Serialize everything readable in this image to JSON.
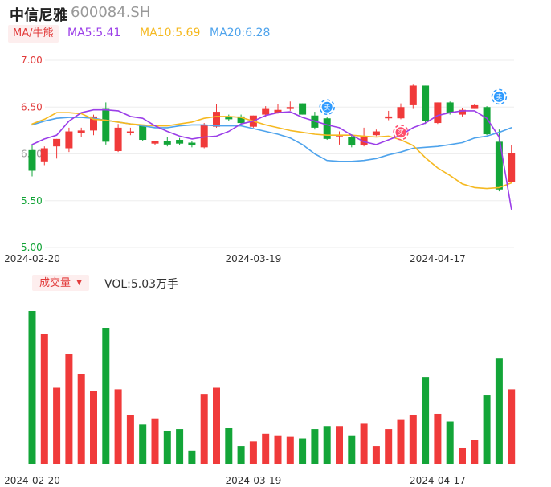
{
  "header": {
    "stock_name": "中信尼雅",
    "stock_code": "600084.SH"
  },
  "legend": {
    "ma_tag": "MA/牛熊",
    "ma5": "MA5:5.41",
    "ma10": "MA10:5.69",
    "ma20": "MA20:6.28"
  },
  "volume_panel": {
    "tag": "成交量",
    "dropdown_arrow": "▼",
    "vol_text": "VOL:5.03万手"
  },
  "markers": {
    "buy_label": "买",
    "sell_label": "卖"
  },
  "colors": {
    "up": "#f03a3a",
    "down": "#13a538",
    "ma5": "#9b3ee8",
    "ma10": "#f5b921",
    "ma20": "#4ea3ec",
    "grid": "#eeeeee",
    "buy_marker": "#ff4d6d",
    "sell_marker": "#2f9bff"
  },
  "chart_data": {
    "type": "candlestick",
    "yticks": [
      "7.00",
      "6.50",
      "6.00",
      "5.50",
      "5.00"
    ],
    "ylim": [
      5.0,
      7.0
    ],
    "xticks": [
      "2024-02-20",
      "2024-03-19",
      "2024-04-17"
    ],
    "xtick_index": [
      0,
      18,
      33
    ],
    "candles": [
      {
        "o": 6.04,
        "h": 6.1,
        "l": 5.76,
        "c": 5.82
      },
      {
        "o": 5.92,
        "h": 6.08,
        "l": 5.88,
        "c": 6.06
      },
      {
        "o": 6.08,
        "h": 6.16,
        "l": 5.95,
        "c": 6.16
      },
      {
        "o": 6.06,
        "h": 6.28,
        "l": 6.02,
        "c": 6.24
      },
      {
        "o": 6.22,
        "h": 6.28,
        "l": 6.18,
        "c": 6.25
      },
      {
        "o": 6.25,
        "h": 6.42,
        "l": 6.2,
        "c": 6.4
      },
      {
        "o": 6.48,
        "h": 6.55,
        "l": 6.1,
        "c": 6.13
      },
      {
        "o": 6.03,
        "h": 6.32,
        "l": 6.02,
        "c": 6.28
      },
      {
        "o": 6.24,
        "h": 6.28,
        "l": 6.2,
        "c": 6.24
      },
      {
        "o": 6.3,
        "h": 6.31,
        "l": 6.14,
        "c": 6.15
      },
      {
        "o": 6.11,
        "h": 6.14,
        "l": 6.09,
        "c": 6.14
      },
      {
        "o": 6.14,
        "h": 6.18,
        "l": 6.08,
        "c": 6.1
      },
      {
        "o": 6.15,
        "h": 6.17,
        "l": 6.09,
        "c": 6.11
      },
      {
        "o": 6.12,
        "h": 6.14,
        "l": 6.07,
        "c": 6.09
      },
      {
        "o": 6.07,
        "h": 6.33,
        "l": 6.06,
        "c": 6.31
      },
      {
        "o": 6.29,
        "h": 6.53,
        "l": 6.28,
        "c": 6.45
      },
      {
        "o": 6.39,
        "h": 6.42,
        "l": 6.35,
        "c": 6.37
      },
      {
        "o": 6.4,
        "h": 6.42,
        "l": 6.3,
        "c": 6.33
      },
      {
        "o": 6.29,
        "h": 6.41,
        "l": 6.28,
        "c": 6.41
      },
      {
        "o": 6.42,
        "h": 6.51,
        "l": 6.39,
        "c": 6.48
      },
      {
        "o": 6.44,
        "h": 6.53,
        "l": 6.43,
        "c": 6.47
      },
      {
        "o": 6.48,
        "h": 6.56,
        "l": 6.46,
        "c": 6.5
      },
      {
        "o": 6.54,
        "h": 6.54,
        "l": 6.42,
        "c": 6.42
      },
      {
        "o": 6.41,
        "h": 6.45,
        "l": 6.26,
        "c": 6.28
      },
      {
        "o": 6.38,
        "h": 6.39,
        "l": 6.15,
        "c": 6.16
      },
      {
        "o": 6.2,
        "h": 6.24,
        "l": 6.1,
        "c": 6.2
      },
      {
        "o": 6.18,
        "h": 6.21,
        "l": 6.07,
        "c": 6.09
      },
      {
        "o": 6.09,
        "h": 6.28,
        "l": 6.08,
        "c": 6.19
      },
      {
        "o": 6.2,
        "h": 6.26,
        "l": 6.19,
        "c": 6.24
      },
      {
        "o": 6.38,
        "h": 6.46,
        "l": 6.36,
        "c": 6.4
      },
      {
        "o": 6.38,
        "h": 6.54,
        "l": 6.37,
        "c": 6.5
      },
      {
        "o": 6.52,
        "h": 6.74,
        "l": 6.48,
        "c": 6.73
      },
      {
        "o": 6.73,
        "h": 6.73,
        "l": 6.32,
        "c": 6.35
      },
      {
        "o": 6.33,
        "h": 6.55,
        "l": 6.32,
        "c": 6.55
      },
      {
        "o": 6.55,
        "h": 6.56,
        "l": 6.42,
        "c": 6.44
      },
      {
        "o": 6.42,
        "h": 6.49,
        "l": 6.4,
        "c": 6.47
      },
      {
        "o": 6.48,
        "h": 6.53,
        "l": 6.48,
        "c": 6.52
      },
      {
        "o": 6.5,
        "h": 6.51,
        "l": 6.2,
        "c": 6.21
      },
      {
        "o": 6.13,
        "h": 6.26,
        "l": 5.6,
        "c": 5.62
      },
      {
        "o": 5.7,
        "h": 6.09,
        "l": 5.69,
        "c": 6.01
      }
    ],
    "ma5": [
      6.1,
      6.16,
      6.2,
      6.35,
      6.44,
      6.47,
      6.47,
      6.46,
      6.4,
      6.38,
      6.3,
      6.24,
      6.19,
      6.16,
      6.18,
      6.19,
      6.24,
      6.32,
      6.35,
      6.41,
      6.44,
      6.45,
      6.39,
      6.35,
      6.31,
      6.28,
      6.2,
      6.13,
      6.1,
      6.15,
      6.2,
      6.28,
      6.33,
      6.41,
      6.44,
      6.46,
      6.46,
      6.38,
      6.18,
      5.41
    ],
    "ma10": [
      6.32,
      6.37,
      6.44,
      6.44,
      6.43,
      6.37,
      6.36,
      6.34,
      6.32,
      6.31,
      6.3,
      6.3,
      6.32,
      6.34,
      6.38,
      6.4,
      6.4,
      6.39,
      6.35,
      6.31,
      6.28,
      6.25,
      6.23,
      6.21,
      6.2,
      6.2,
      6.2,
      6.19,
      6.18,
      6.19,
      6.15,
      6.09,
      5.96,
      5.85,
      5.77,
      5.68,
      5.64,
      5.63,
      5.64,
      5.69
    ],
    "ma20": [
      6.31,
      6.35,
      6.38,
      6.39,
      6.39,
      6.38,
      6.36,
      6.34,
      6.32,
      6.3,
      6.28,
      6.28,
      6.3,
      6.31,
      6.31,
      6.3,
      6.3,
      6.3,
      6.27,
      6.24,
      6.21,
      6.17,
      6.1,
      6.0,
      5.93,
      5.92,
      5.92,
      5.93,
      5.95,
      5.99,
      6.02,
      6.06,
      6.07,
      6.08,
      6.1,
      6.12,
      6.17,
      6.19,
      6.23,
      6.28
    ],
    "volume": [
      100,
      85,
      50,
      72,
      59,
      48,
      89,
      49,
      32,
      26,
      30,
      22,
      23,
      9,
      46,
      50,
      24,
      12,
      15,
      20,
      19,
      18,
      17,
      23,
      25,
      25,
      19,
      27,
      12,
      23,
      29,
      32,
      57,
      33,
      28,
      11,
      16,
      45,
      69,
      49
    ],
    "signals": [
      {
        "index": 24,
        "type": "sell",
        "price": 6.5
      },
      {
        "index": 30,
        "type": "buy",
        "price": 6.23
      },
      {
        "index": 38,
        "type": "sell",
        "price": 6.61
      }
    ]
  }
}
